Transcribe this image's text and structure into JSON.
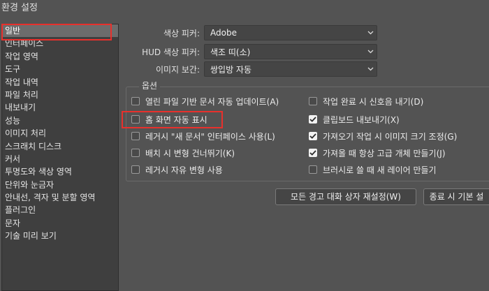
{
  "window": {
    "title": "환경 설정"
  },
  "sidebar": {
    "items": [
      {
        "label": "일반",
        "selected": true
      },
      {
        "label": "인터페이스"
      },
      {
        "label": "작업 영역"
      },
      {
        "label": "도구"
      },
      {
        "label": "작업 내역"
      },
      {
        "label": "파일 처리"
      },
      {
        "label": "내보내기"
      },
      {
        "label": "성능"
      },
      {
        "label": "이미지 처리"
      },
      {
        "label": "스크래치 디스크"
      },
      {
        "label": "커서"
      },
      {
        "label": "투명도와 색상 영역"
      },
      {
        "label": "단위와 눈금자"
      },
      {
        "label": "안내선, 격자 및 분할 영역"
      },
      {
        "label": "플러그인"
      },
      {
        "label": "문자"
      },
      {
        "label": "기술 미리 보기"
      }
    ]
  },
  "fields": {
    "color_picker": {
      "label": "색상 피커:",
      "value": "Adobe"
    },
    "hud_color_picker": {
      "label": "HUD 색상 피커:",
      "value": "색조 띠(소)"
    },
    "image_interpolation": {
      "label": "이미지 보간:",
      "value": "쌍입방 자동"
    }
  },
  "options": {
    "legend": "옵션",
    "left": [
      {
        "label": "열린 파일 기반 문서 자동 업데이트(A)",
        "checked": false
      },
      {
        "label": "홈 화면 자동 표시",
        "checked": false
      },
      {
        "label": "레거시 \"새 문서\" 인터페이스 사용(L)",
        "checked": false
      },
      {
        "label": "배치 시 변형 건너뛰기(K)",
        "checked": false
      },
      {
        "label": "레거시 자유 변형 사용",
        "checked": false
      }
    ],
    "right": [
      {
        "label": "작업 완료 시 신호음 내기(D)",
        "checked": false
      },
      {
        "label": "클립보드 내보내기(X)",
        "checked": true
      },
      {
        "label": "가져오기 작업 시 이미지 크기 조정(G)",
        "checked": true
      },
      {
        "label": "가져올 때 항상 고급 개체 만들기(J)",
        "checked": true
      },
      {
        "label": "브러시로 쓸 때 새 레이어 만들기",
        "checked": false
      }
    ]
  },
  "buttons": {
    "reset_warnings": "모든 경고 대화 상자 재설정(W)",
    "reset_on_quit": "종료 시 기본 설"
  },
  "colors": {
    "background": "#535353",
    "sidebar_bg": "#3f3f3f",
    "selected": "#6c6c6c",
    "highlight_red": "#e8302c"
  }
}
